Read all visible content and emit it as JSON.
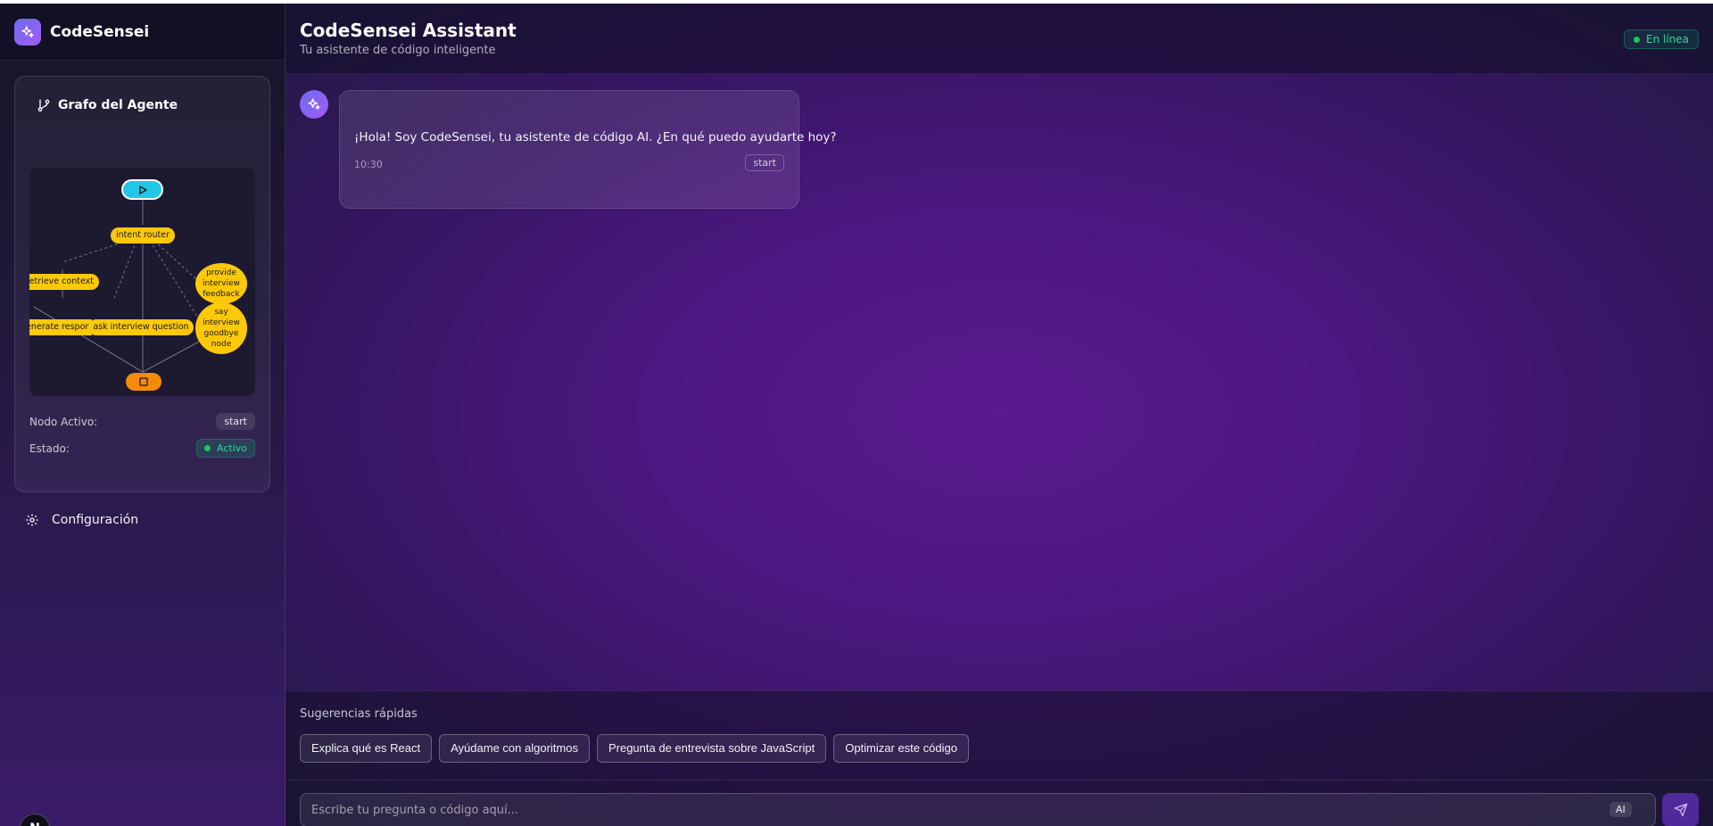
{
  "sidebar": {
    "brand": {
      "name": "CodeSensei",
      "icon": "sparkles-icon"
    },
    "graph": {
      "title": "Grafo del Agente",
      "icon": "git-branch-icon",
      "nodes": {
        "intent_router": "intent router",
        "retrieve_context": "retrieve context",
        "generate_response": "generate response",
        "ask_interview_question": "ask interview question",
        "provide_interview_feedback": "provide interview feedback",
        "say_interview_goodbye": "say interview goodbye node"
      },
      "active_node_label": "Nodo Activo:",
      "active_node_value": "start",
      "status_label": "Estado:",
      "status_value": "Activo"
    },
    "settings": {
      "label": "Configuración",
      "icon": "gear-icon"
    },
    "avatar_initial": "N"
  },
  "header": {
    "title": "CodeSensei Assistant",
    "subtitle": "Tu asistente de código inteligente",
    "status": "En línea"
  },
  "messages": [
    {
      "sender": "assistant",
      "text": "¡Hola! Soy CodeSensei, tu asistente de código AI. ¿En qué puedo ayudarte hoy?",
      "time": "10:30",
      "node": "start"
    }
  ],
  "suggestions": {
    "title": "Sugerencias rápidas",
    "items": [
      "Explica qué es React",
      "Ayúdame con algoritmos",
      "Pregunta de entrevista sobre JavaScript",
      "Optimizar este código"
    ]
  },
  "composer": {
    "placeholder": "Escribe tu pregunta o código aquí...",
    "badge": "AI",
    "send_icon": "send-icon"
  },
  "colors": {
    "accent": "#7c3aed",
    "node_yellow": "#fbc908",
    "start_node": "#22c7e8",
    "end_node": "#f58a0b",
    "online_green": "#34d399"
  }
}
